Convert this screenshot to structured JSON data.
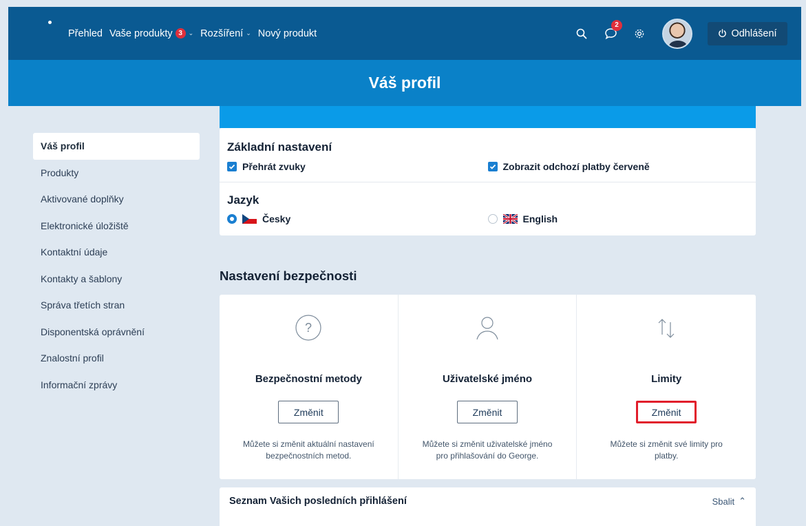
{
  "nav": {
    "items": [
      {
        "label": "Přehled"
      },
      {
        "label": "Vaše produkty",
        "badge": "3",
        "dropdown": true
      },
      {
        "label": "Rozšíření",
        "dropdown": true
      },
      {
        "label": "Nový produkt"
      }
    ],
    "messages_badge": "2",
    "logout_label": "Odhlášení"
  },
  "page": {
    "title": "Váš profil"
  },
  "sidebar": {
    "items": [
      {
        "label": "Váš profil",
        "active": true
      },
      {
        "label": "Produkty"
      },
      {
        "label": "Aktivované doplňky"
      },
      {
        "label": "Elektronické úložiště"
      },
      {
        "label": "Kontaktní údaje"
      },
      {
        "label": "Kontakty a šablony"
      },
      {
        "label": "Správa třetích stran"
      },
      {
        "label": "Disponentská oprávnění"
      },
      {
        "label": "Znalostní profil"
      },
      {
        "label": "Informační zprávy"
      }
    ]
  },
  "basic": {
    "heading": "Základní nastavení",
    "options": [
      {
        "label": "Přehrát zvuky",
        "checked": true
      },
      {
        "label": "Zobrazit odchozí platby červeně",
        "checked": true
      }
    ]
  },
  "language": {
    "heading": "Jazyk",
    "options": [
      {
        "label": "Česky",
        "selected": true,
        "flag": "cz-flag"
      },
      {
        "label": "English",
        "selected": false,
        "flag": "uk-flag"
      }
    ]
  },
  "security": {
    "heading": "Nastavení bezpečnosti",
    "cards": [
      {
        "icon": "question-circle-icon",
        "title": "Bezpečnostní metody",
        "button": "Změnit",
        "description": "Můžete si změnit aktuální nastavení bezpečnostních metod."
      },
      {
        "icon": "user-icon",
        "title": "Uživatelské jméno",
        "button": "Změnit",
        "description": "Můžete si změnit uživatelské jméno pro přihlašování do George."
      },
      {
        "icon": "arrows-up-down-icon",
        "title": "Limity",
        "button": "Změnit",
        "description": "Můžete si změnit své limity pro platby.",
        "highlighted": true
      }
    ]
  },
  "history": {
    "title": "Seznam Vašich posledních přihlášení",
    "collapse_label": "Sbalit"
  },
  "colors": {
    "nav_bg": "#0a5a92",
    "profile_bar": "#0a81c8",
    "accent": "#1a7fd1",
    "highlight": "#e11d2b",
    "badge": "#e0303c"
  }
}
